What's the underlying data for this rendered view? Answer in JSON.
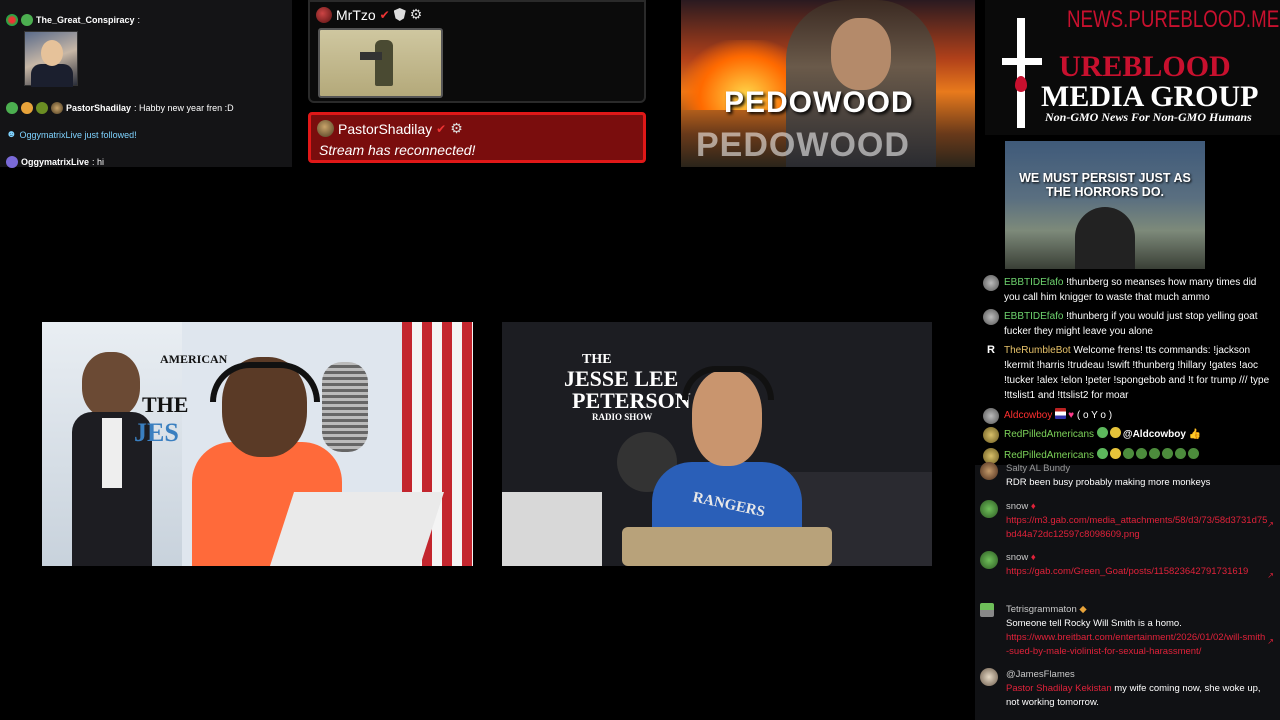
{
  "top_left_chat": {
    "line1": {
      "user": "The_Great_Conspiracy",
      "sep": " :"
    },
    "line2": {
      "user": "PastorShadilay",
      "message": " :  Habby new year fren :D"
    },
    "line3": {
      "text": "OggymatrixLive just followed!"
    },
    "line4": {
      "user": "OggymatrixLive",
      "message": " :  hi"
    }
  },
  "alerts": {
    "follower": {
      "user": "MrTzo"
    },
    "reconnect": {
      "user": "PastorShadilay",
      "message": "Stream has reconnected!"
    }
  },
  "banner": {
    "title_top": "PEDOWOOD",
    "title_bottom": "PEDOWOOD"
  },
  "logo": {
    "url": "NEWS.PUREBLOOD.MEDIA",
    "line1": "UREBLOOD",
    "line2": "MEDIA GROUP",
    "tagline": "Non-GMO News For Non-GMO Humans"
  },
  "persist_image": {
    "text": "WE MUST PERSIST JUST AS THE HORRORS DO."
  },
  "right_chat": [
    {
      "user": "EBBTIDEfafo",
      "message": "!thunberg so meanses how many times did you call him knigger to waste that much ammo"
    },
    {
      "user": "EBBTIDEfafo",
      "message": "!thunberg if you would just stop yelling goat fucker they might leave you alone"
    },
    {
      "user": "TheRumbleBot",
      "message": "Welcome frens! tts commands: !jackson !kermit !harris !trudeau !swift !thunberg !hillary !gates !aoc !tucker !alex !elon !peter !spongebob and !t for trump /// type !ttslist1 and !ttslist2 for moar"
    },
    {
      "user": "Aldcowboy",
      "message": "( o Y o )"
    },
    {
      "user": "RedPilledAmericans",
      "message": "@Aldcowboy"
    },
    {
      "user": "RedPilledAmericans",
      "message": ""
    }
  ],
  "rumble_chat": [
    {
      "user": "Salty AL Bundy",
      "message": "RDR been busy probably making more monkeys"
    },
    {
      "user": "snow",
      "link": "https://m3.gab.com/media_attachments/58/d3/73/58d3731d75bd44a72dc12597c8098609.png"
    },
    {
      "user": "snow",
      "link": "https://gab.com/Green_Goat/posts/115823642791731619"
    },
    {
      "user": "Tetrisgrammaton",
      "message": "Someone tell Rocky Will Smith is a homo.",
      "link": "https://www.breitbart.com/entertainment/2026/01/02/will-smith-sued-by-male-violinist-for-sexual-harassment/"
    },
    {
      "user": "@JamesFlames",
      "mention": "Pastor Shadilay Kekistan",
      "message": " my wife coming now, she woke up, not working tomorrow."
    }
  ],
  "video_left": {
    "logo1": "AMERICAN",
    "logo2": "THE",
    "logo3": "JES"
  },
  "video_right": {
    "logo1": "THE",
    "logo2": "JESSE LEE",
    "logo3": "PETERSON",
    "logo4": "RADIO SHOW",
    "shirt": "RANGERS"
  },
  "colors": {
    "alert_red": "#e01818",
    "link_red": "#e0223a",
    "name_green": "#6ed36e",
    "name_red": "#ff3030"
  }
}
